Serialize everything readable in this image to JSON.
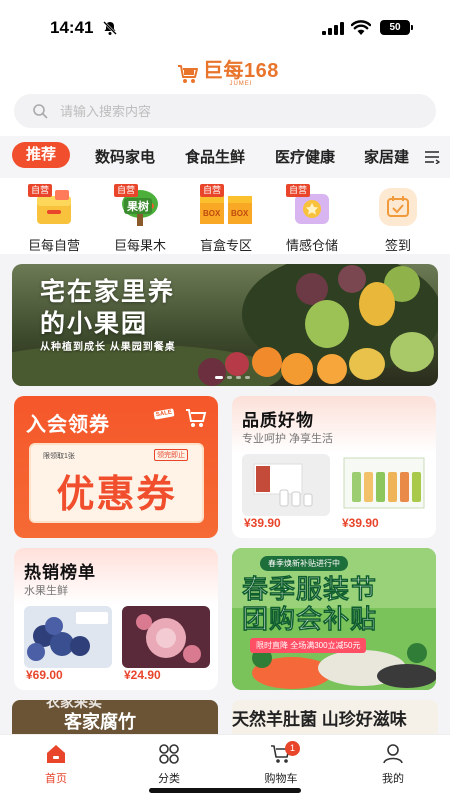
{
  "status_bar": {
    "time": "14:41",
    "battery": "50"
  },
  "header": {
    "logo_name": "巨每168",
    "logo_sub": "JUMEI",
    "search_placeholder": "请输入搜索内容"
  },
  "categories": {
    "active": "推荐",
    "items": [
      "数码家电",
      "食品生鲜",
      "医疗健康",
      "家居建"
    ]
  },
  "quick_nav": [
    {
      "label": "巨每自营",
      "tag": "自营",
      "icon": "box-icon"
    },
    {
      "label": "巨每果木",
      "tag": "自营",
      "icon": "fruit-tree-icon",
      "icon_text": "果树"
    },
    {
      "label": "盲盒专区",
      "tag": "自营",
      "icon": "blind-box-icon",
      "icon_text": "BOX"
    },
    {
      "label": "情感仓储",
      "tag": "自营",
      "icon": "heart-gift-icon"
    },
    {
      "label": "签到",
      "tag": "",
      "icon": "calendar-check-icon"
    }
  ],
  "banner": {
    "line1": "宅在家里养",
    "line2": "的小果园",
    "subtitle": "从种植到成长 从果园到餐桌"
  },
  "member_card": {
    "title": "入会领券",
    "sale": "SALE",
    "coupon_left": "限领取1张",
    "coupon_right": "领完即止",
    "coupon_text": "优惠券"
  },
  "quality_card": {
    "title": "品质好物",
    "subtitle": "专业呵护 净享生活",
    "prices": [
      "¥39.90",
      "¥39.90"
    ]
  },
  "hot_card": {
    "title": "热销榜单",
    "subtitle": "水果生鲜",
    "prices": [
      "¥69.00",
      "¥24.90"
    ]
  },
  "spring_card": {
    "top": "春季焕新补贴进行中",
    "line1": "春季服装节",
    "line2": "团购会补贴",
    "strip": "限时直降 全场满300立减50元"
  },
  "bottom_strip": {
    "left_top": "农家采实",
    "left": "客家腐竹",
    "right": "天然羊肚菌 山珍好滋味"
  },
  "tabbar": {
    "items": [
      "首页",
      "分类",
      "购物车",
      "我的"
    ],
    "cart_badge": "1"
  },
  "colors": {
    "accent": "#f04e2c",
    "logo": "#e8752b",
    "price": "#e8452b"
  }
}
